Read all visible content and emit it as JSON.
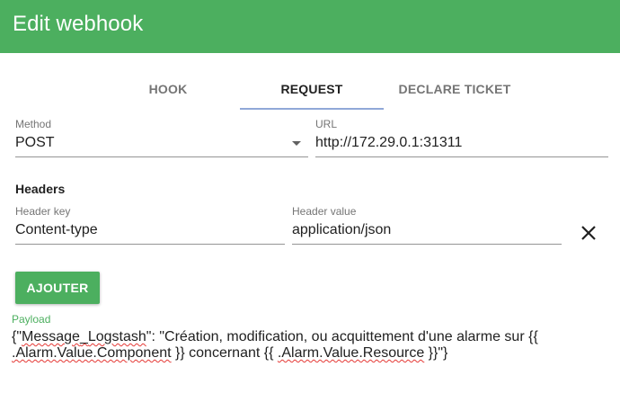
{
  "window": {
    "title": "Edit webhook"
  },
  "tabs": [
    {
      "label": "HOOK",
      "active": false
    },
    {
      "label": "REQUEST",
      "active": true
    },
    {
      "label": "DECLARE TICKET",
      "active": false
    }
  ],
  "request": {
    "method": {
      "label": "Method",
      "value": "POST"
    },
    "url": {
      "label": "URL",
      "value": "http://172.29.0.1:31311"
    }
  },
  "headers": {
    "heading": "Headers",
    "key": {
      "label": "Header key",
      "value": "Content-type"
    },
    "value": {
      "label": "Header value",
      "value": "application/json"
    },
    "remove_icon": "close-icon"
  },
  "add_button": {
    "label": "AJOUTER"
  },
  "payload": {
    "label": "Payload",
    "text_prefix": "{\"",
    "text_key_a": "Message",
    "text_key_sep": "_",
    "text_key_b": "Logstash",
    "text_mid": "\": \"Création, modification, ou acquittement d'une alarme sur {{ ",
    "text_component": ".Alarm.Value.Component",
    "text_mid2": " }} concernant {{ ",
    "text_resource": ".Alarm.Value.Resource",
    "text_suffix": " }}\"}"
  },
  "colors": {
    "accent": "#4caf5f",
    "tab_indicator": "#90a8d8"
  }
}
